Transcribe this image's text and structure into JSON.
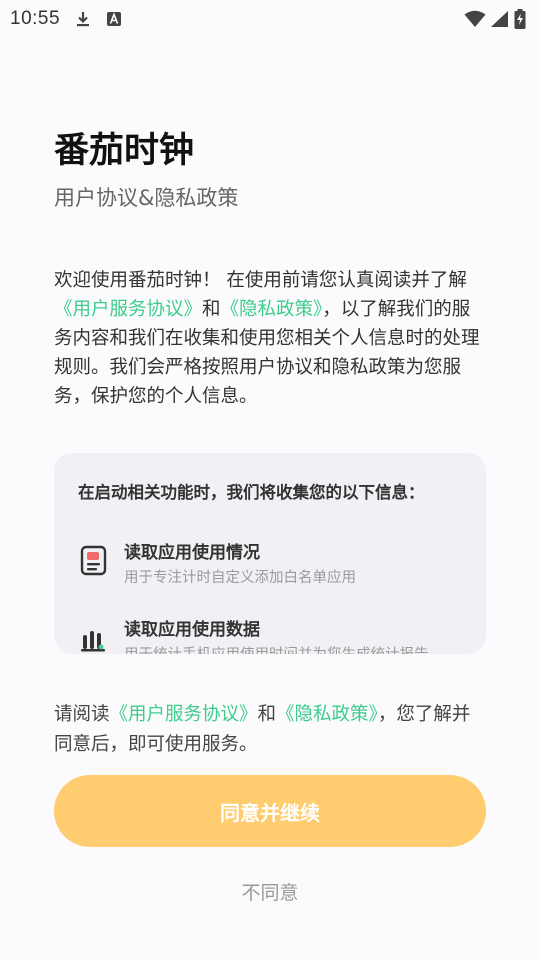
{
  "status_bar": {
    "time": "10:55",
    "icons": [
      "download-icon",
      "font-a-icon",
      "wifi-icon",
      "cellular-signal-icon",
      "battery-charging-icon"
    ]
  },
  "header": {
    "title": "番茄时钟",
    "subtitle": "用户协议&隐私政策"
  },
  "intro": {
    "part1": "欢迎使用番茄时钟！ 在使用前请您认真阅读并了解",
    "link_agreement": "《用户服务协议》",
    "and": "和",
    "link_privacy": "《隐私政策》",
    "part2": "，以了解我们的服务内容和我们在收集和使用您相关个人信息时的处理规则。我们会严格按照用户协议和隐私政策为您服务，保护您的个人信息。"
  },
  "info_card": {
    "title": "在启动相关功能时，我们将收集您的以下信息：",
    "items": [
      {
        "icon": "app-usage-icon",
        "title": "读取应用使用情况",
        "desc": "用于专注计时自定义添加白名单应用"
      },
      {
        "icon": "bar-stats-icon",
        "title": "读取应用使用数据",
        "desc": "用于统计手机应用使用时间并为您生成统计报告"
      }
    ]
  },
  "consent": {
    "prefix": "请阅读",
    "link_agreement": "《用户服务协议》",
    "and": "和",
    "link_privacy": "《隐私政策》",
    "suffix": "，您了解并同意后，即可使用服务。"
  },
  "buttons": {
    "agree": "同意并继续",
    "disagree": "不同意"
  },
  "colors": {
    "accent_link": "#3ecd8c",
    "primary_button": "#ffcd70",
    "background": "#fbfbfd",
    "card_background": "#f1f1f5"
  }
}
